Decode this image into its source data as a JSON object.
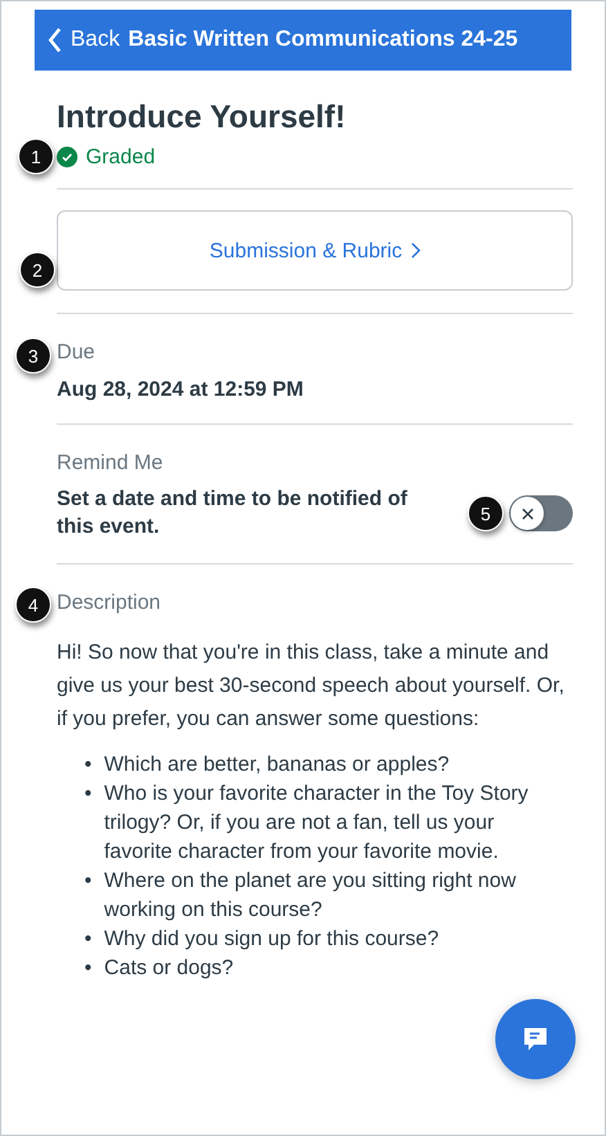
{
  "header": {
    "back_label": "Back",
    "title": "Basic Written Communications 24-25"
  },
  "assignment": {
    "title": "Introduce Yourself!",
    "status": "Graded",
    "graded": true
  },
  "submission_button": {
    "label": "Submission & Rubric"
  },
  "due": {
    "label": "Due",
    "value": "Aug 28, 2024 at 12:59 PM"
  },
  "reminder": {
    "label": "Remind Me",
    "text": "Set a date and time to be notified of this event.",
    "on": false
  },
  "description": {
    "label": "Description",
    "paragraph": "Hi! So now that you're in this class, take a minute and give us your best 30-second speech about yourself. Or, if you prefer, you can answer some questions:",
    "bullets": [
      {
        "marker": "•",
        "text": "Which are better, bananas or apples?"
      },
      {
        "marker": "•",
        "text": "Who is your favorite character in the Toy Story trilogy? Or, if you are not a fan, tell us your favorite character from your favorite movie."
      },
      {
        "marker": "•",
        "text": "Where on the planet are you sitting right now working on this course?"
      },
      {
        "marker": "•",
        "text": "Why did you sign up for this course?"
      },
      {
        "marker": "•",
        "text": "Cats or dogs?"
      }
    ]
  },
  "callouts": [
    "1",
    "2",
    "3",
    "4",
    "5"
  ]
}
